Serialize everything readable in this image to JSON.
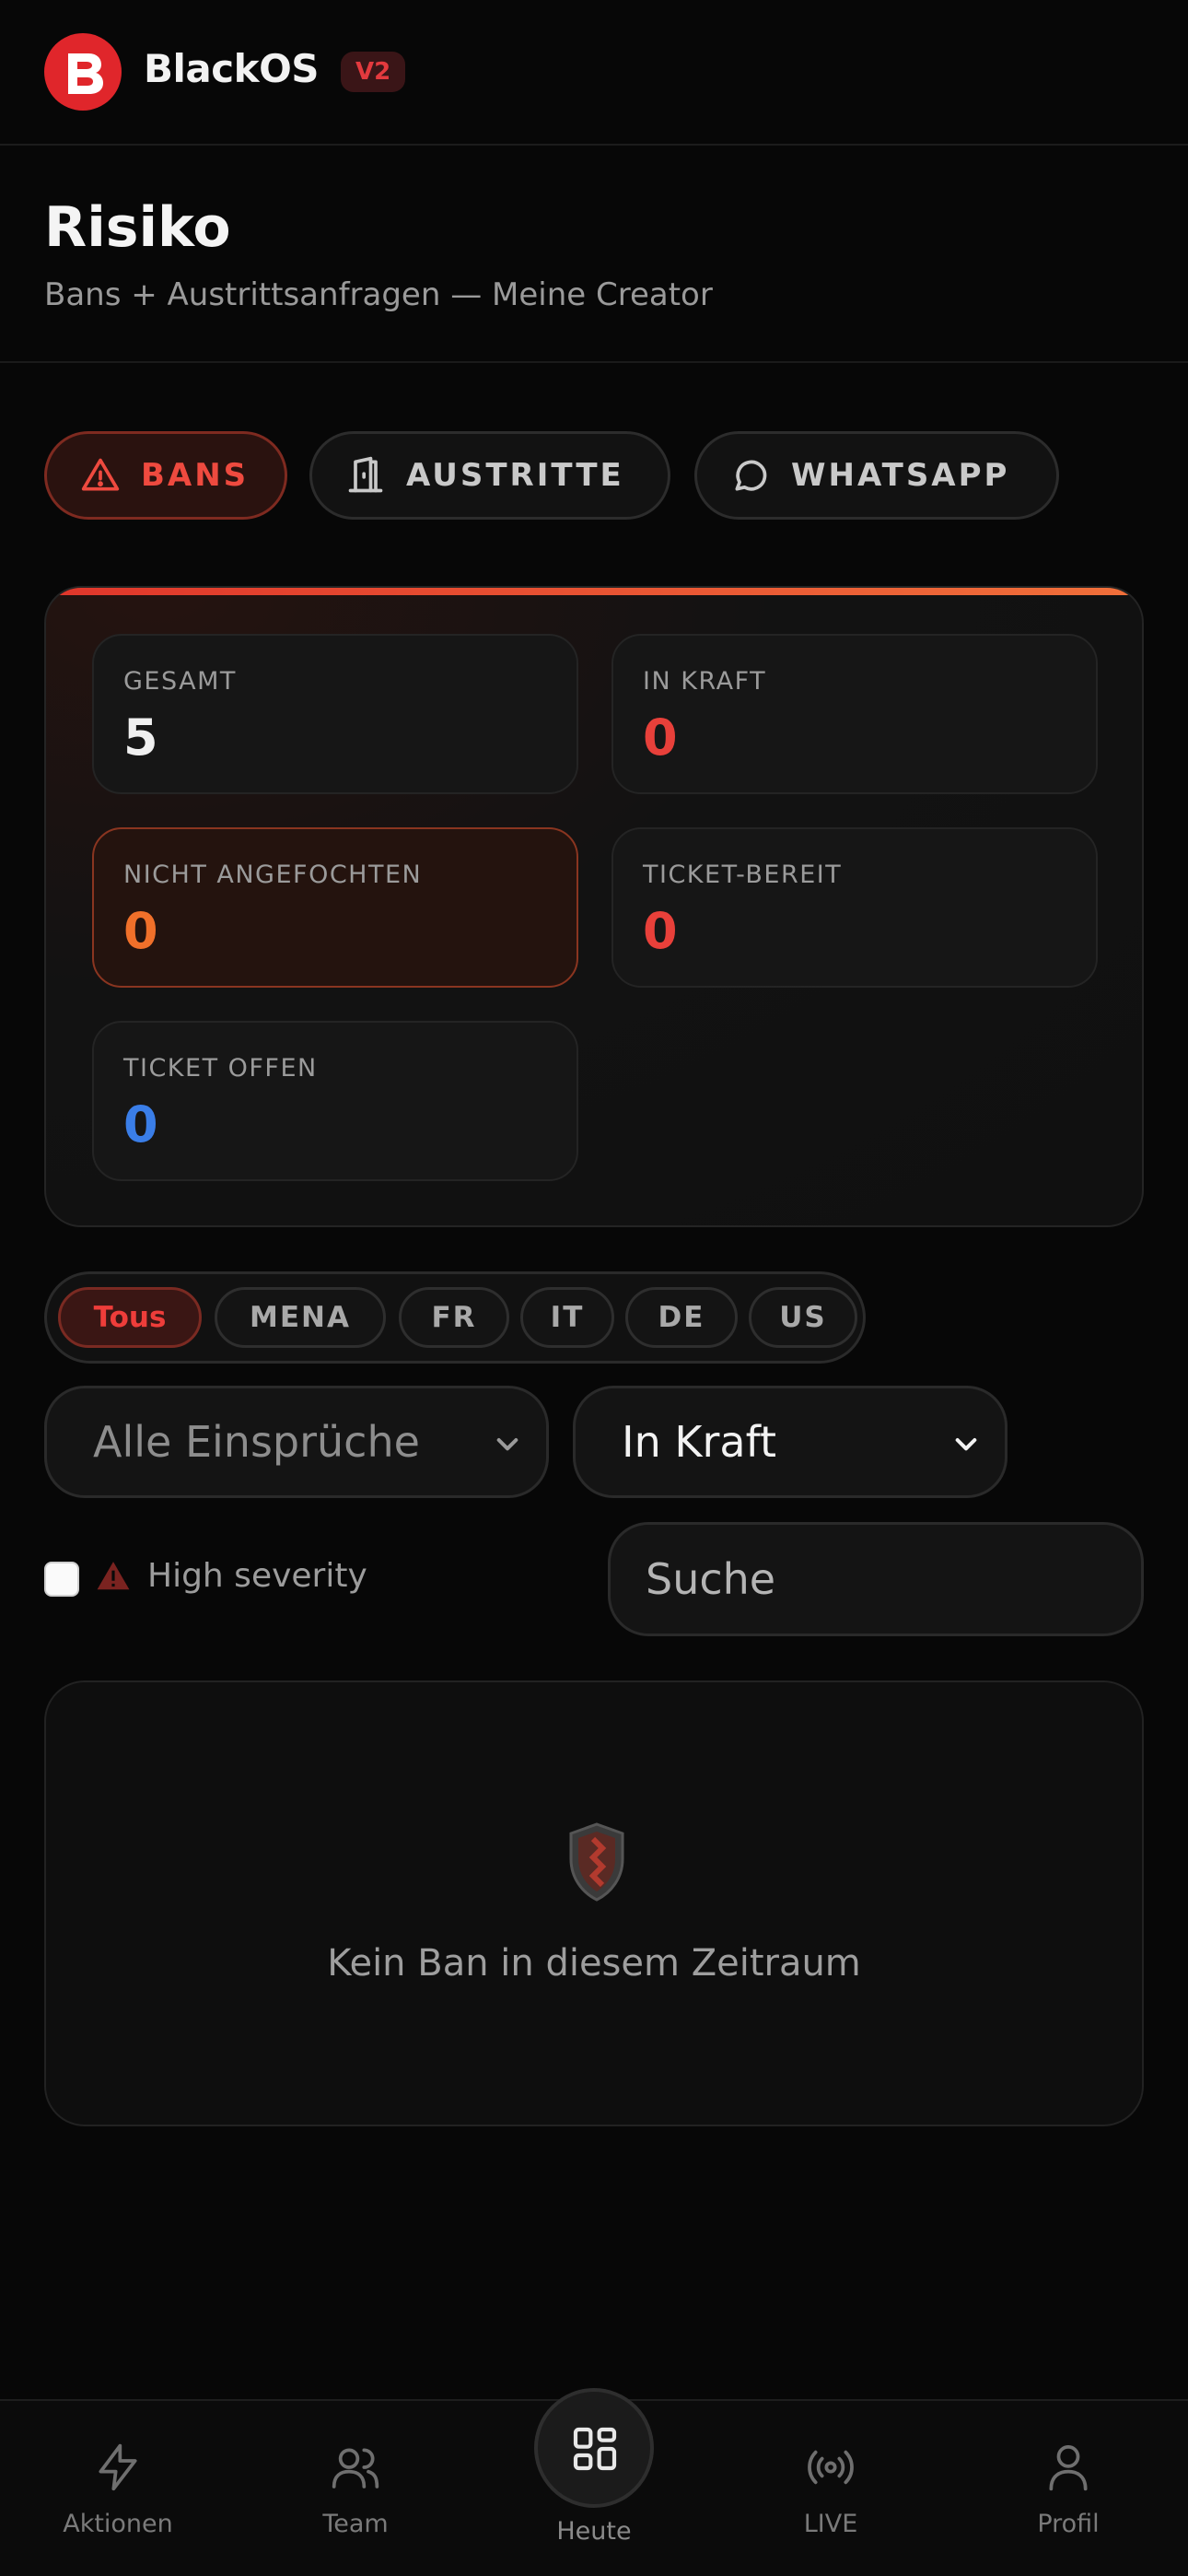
{
  "header": {
    "brand": "BlackOS",
    "version": "V2"
  },
  "page": {
    "title": "Risiko",
    "subtitle": "Bans + Austrittsanfragen — Meine Creator"
  },
  "tabs": [
    {
      "label": "BANS",
      "icon": "warning-triangle-icon",
      "active": true
    },
    {
      "label": "AUSTRITTE",
      "icon": "door-exit-icon",
      "active": false
    },
    {
      "label": "WHATSAPP",
      "icon": "chat-bubble-icon",
      "active": false
    }
  ],
  "stats": [
    {
      "label": "GESAMT",
      "value": "5",
      "color": "#f0f0f0"
    },
    {
      "label": "IN KRAFT",
      "value": "0",
      "color": "#e8403a"
    },
    {
      "label": "NICHT ANGEFOCHTEN",
      "value": "0",
      "color": "#f0702a"
    },
    {
      "label": "TICKET-BEREIT",
      "value": "0",
      "color": "#e8403a"
    },
    {
      "label": "TICKET OFFEN",
      "value": "0",
      "color": "#3a7ee8"
    }
  ],
  "regions": [
    {
      "label": "Tous",
      "active": true
    },
    {
      "label": "MENA",
      "active": false
    },
    {
      "label": "FR",
      "active": false
    },
    {
      "label": "IT",
      "active": false
    },
    {
      "label": "DE",
      "active": false
    },
    {
      "label": "US",
      "active": false
    }
  ],
  "filters": {
    "appeal_select": "Alle Einsprüche",
    "status_select": "In Kraft",
    "high_severity_label": "High severity",
    "high_severity_checked": false,
    "search_placeholder": "Suche"
  },
  "empty_state": {
    "text": "Kein Ban in diesem Zeitraum",
    "icon": "shield-icon"
  },
  "bottom_nav": [
    {
      "label": "Aktionen",
      "icon": "lightning-icon"
    },
    {
      "label": "Team",
      "icon": "users-icon"
    },
    {
      "label": "Heute",
      "icon": "grid-icon",
      "center": true
    },
    {
      "label": "LIVE",
      "icon": "broadcast-icon"
    },
    {
      "label": "Profil",
      "icon": "user-icon"
    }
  ],
  "colors": {
    "accent_red": "#e0262b",
    "accent_orange": "#f0702a",
    "accent_blue": "#3a7ee8",
    "background": "#070707"
  }
}
